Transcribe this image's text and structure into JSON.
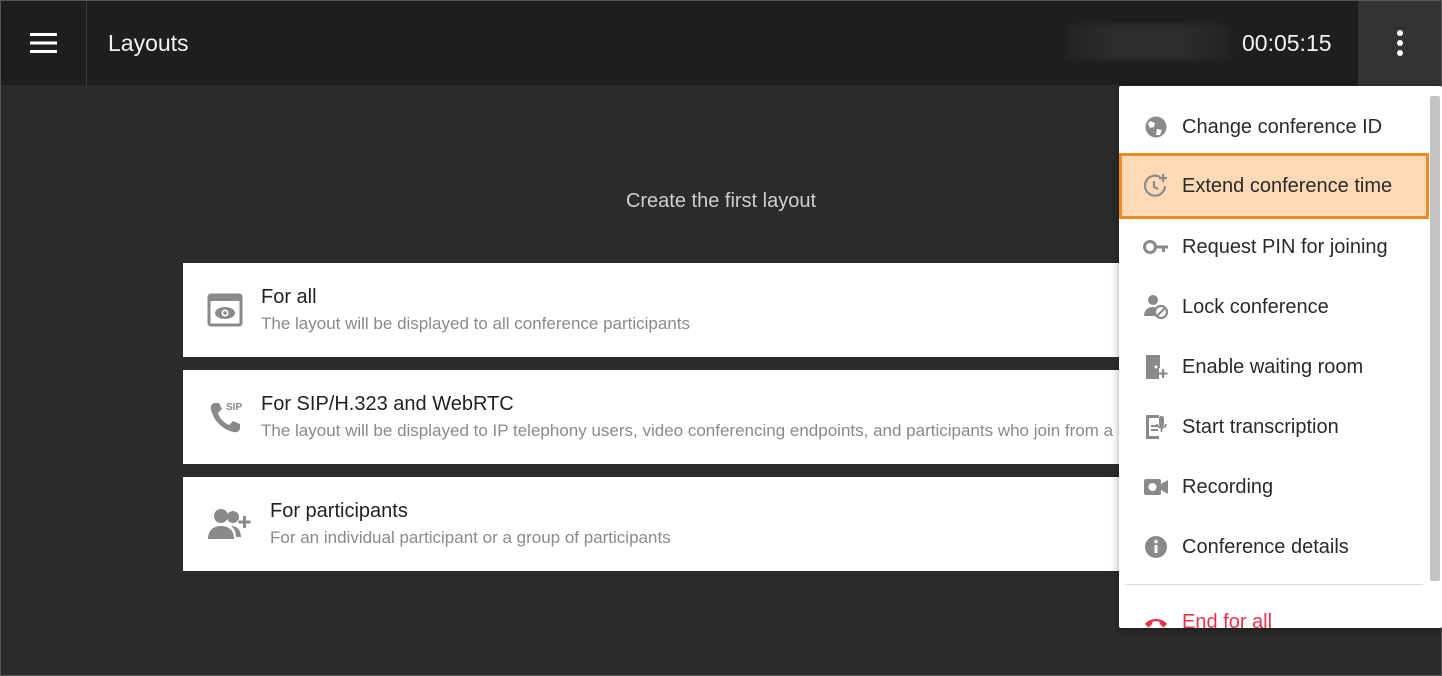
{
  "header": {
    "title": "Layouts",
    "timer": "00:05:15"
  },
  "main": {
    "heading": "Create the first layout",
    "cards": [
      {
        "title": "For all",
        "desc": "The layout will be displayed to all conference participants",
        "icon": "eye-window-icon"
      },
      {
        "title": "For SIP/H.323 and WebRTC",
        "desc": "The layout will be displayed to IP telephony users, video conferencing endpoints, and participants who join from a browser",
        "icon": "sip-phone-icon"
      },
      {
        "title": "For participants",
        "desc": "For an individual participant or a group of participants",
        "icon": "add-users-icon"
      }
    ]
  },
  "menu": {
    "items": [
      {
        "label": "Change conference ID",
        "icon": "globe-icon"
      },
      {
        "label": "Extend conference time",
        "icon": "clock-plus-icon"
      },
      {
        "label": "Request PIN for joining",
        "icon": "key-icon"
      },
      {
        "label": "Lock conference",
        "icon": "user-block-icon"
      },
      {
        "label": "Enable waiting room",
        "icon": "door-plus-icon"
      },
      {
        "label": "Start transcription",
        "icon": "transcription-icon"
      },
      {
        "label": "Recording",
        "icon": "camera-icon"
      },
      {
        "label": "Conference details",
        "icon": "info-icon"
      }
    ],
    "end_label": "End for all",
    "active_color": "#fdd9b5",
    "active_border": "#f08a24",
    "danger_color": "#e8334d"
  }
}
